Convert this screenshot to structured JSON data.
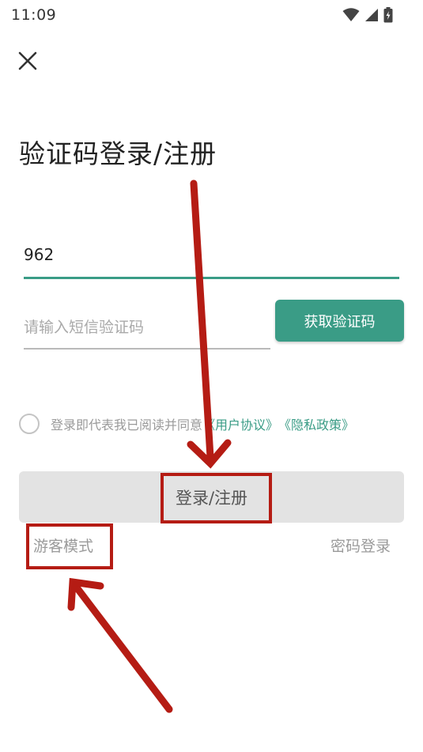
{
  "status_bar": {
    "time": "11:09",
    "icons": [
      "wifi-icon",
      "signal-icon",
      "battery-charging-icon"
    ]
  },
  "header": {
    "close_icon": "close-icon",
    "title": "验证码登录/注册"
  },
  "form": {
    "phone_value": "962",
    "code_placeholder": "请输入短信验证码",
    "get_code_label": "获取验证码"
  },
  "agreement": {
    "text": "登录即代表我已阅读并同意",
    "user_agreement": "《用户协议》",
    "privacy_policy": "《隐私政策》"
  },
  "actions": {
    "login_register_label": "登录/注册",
    "guest_mode_label": "游客模式",
    "password_login_label": "密码登录"
  },
  "annotations": {
    "color": "#b51c14"
  },
  "colors": {
    "accent": "#3a9c86",
    "disabled_button": "#e3e3e3"
  }
}
